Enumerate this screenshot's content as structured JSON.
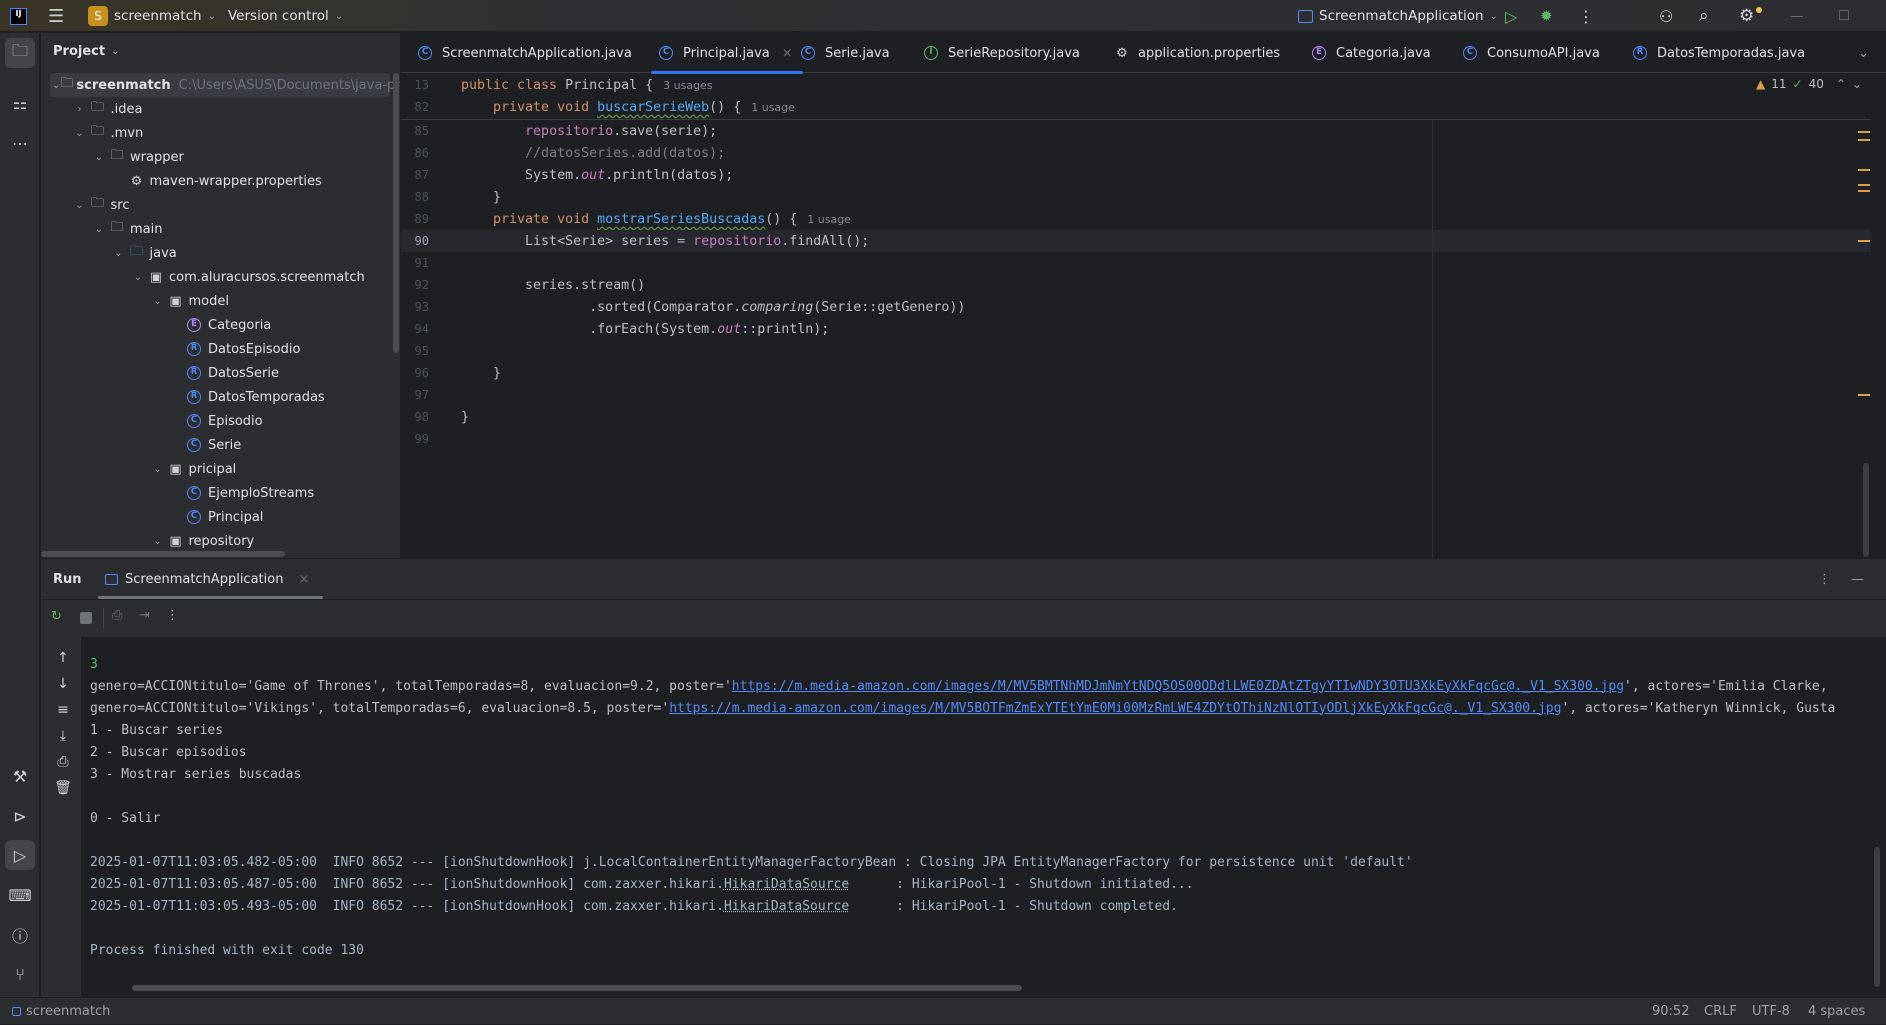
{
  "titlebar": {
    "project_initial": "S",
    "project_name": "screenmatch",
    "vcs": "Version control",
    "run_config": "ScreenmatchApplication"
  },
  "colors": {
    "accent": "#3574f0",
    "run_green": "#5fb865",
    "project_badge": "#c7911b",
    "warning": "#d9a343"
  },
  "project_panel": {
    "title": "Project",
    "items": [
      {
        "label": "screenmatch",
        "path": "C:\\Users\\ASUS\\Documents\\java-pr",
        "depth": 0,
        "arrow": "down",
        "icon": "module-folder"
      },
      {
        "label": ".idea",
        "depth": 1,
        "arrow": "right",
        "icon": "folder"
      },
      {
        "label": ".mvn",
        "depth": 1,
        "arrow": "down",
        "icon": "folder"
      },
      {
        "label": "wrapper",
        "depth": 2,
        "arrow": "down",
        "icon": "folder"
      },
      {
        "label": "maven-wrapper.properties",
        "depth": 3,
        "arrow": "",
        "icon": "gear"
      },
      {
        "label": "src",
        "depth": 1,
        "arrow": "down",
        "icon": "folder"
      },
      {
        "label": "main",
        "depth": 2,
        "arrow": "down",
        "icon": "folder"
      },
      {
        "label": "java",
        "depth": 3,
        "arrow": "down",
        "icon": "source-folder"
      },
      {
        "label": "com.aluracursos.screenmatch",
        "depth": 4,
        "arrow": "down",
        "icon": "package"
      },
      {
        "label": "model",
        "depth": 5,
        "arrow": "down",
        "icon": "package"
      },
      {
        "label": "Categoria",
        "depth": 6,
        "arrow": "",
        "icon": "enum"
      },
      {
        "label": "DatosEpisodio",
        "depth": 6,
        "arrow": "",
        "icon": "record"
      },
      {
        "label": "DatosSerie",
        "depth": 6,
        "arrow": "",
        "icon": "record"
      },
      {
        "label": "DatosTemporadas",
        "depth": 6,
        "arrow": "",
        "icon": "record"
      },
      {
        "label": "Episodio",
        "depth": 6,
        "arrow": "",
        "icon": "class"
      },
      {
        "label": "Serie",
        "depth": 6,
        "arrow": "",
        "icon": "class"
      },
      {
        "label": "pricipal",
        "depth": 5,
        "arrow": "down",
        "icon": "package"
      },
      {
        "label": "EjemploStreams",
        "depth": 6,
        "arrow": "",
        "icon": "class"
      },
      {
        "label": "Principal",
        "depth": 6,
        "arrow": "",
        "icon": "class"
      },
      {
        "label": "repository",
        "depth": 5,
        "arrow": "down",
        "icon": "package"
      }
    ]
  },
  "editor": {
    "tabs": [
      {
        "label": "ScreenmatchApplication.java",
        "icon": "class",
        "active": false
      },
      {
        "label": "Principal.java",
        "icon": "class",
        "active": true
      },
      {
        "label": "Serie.java",
        "icon": "class",
        "active": false
      },
      {
        "label": "SerieRepository.java",
        "icon": "interface",
        "active": false
      },
      {
        "label": "application.properties",
        "icon": "gear",
        "active": false
      },
      {
        "label": "Categoria.java",
        "icon": "enum",
        "active": false
      },
      {
        "label": "ConsumoAPI.java",
        "icon": "class",
        "active": false
      },
      {
        "label": "DatosTemporadas.java",
        "icon": "record",
        "active": false
      }
    ],
    "warnings": "11",
    "ok_count": "40",
    "sticky_lines": [
      {
        "n": "13",
        "tokens": [
          [
            "public class ",
            "k"
          ],
          [
            "Principal {",
            "t"
          ]
        ],
        "hint": "3 usages"
      },
      {
        "n": "82",
        "tokens": [
          [
            "    private void ",
            "k"
          ],
          [
            "buscarSerieWeb",
            "f"
          ],
          [
            "() {",
            "t"
          ]
        ],
        "hint": "1 usage"
      }
    ],
    "lines": [
      {
        "n": "85",
        "tokens": [
          [
            "        ",
            "t"
          ],
          [
            "repositorio",
            "fld"
          ],
          [
            ".save(serie);",
            "t"
          ]
        ]
      },
      {
        "n": "86",
        "tokens": [
          [
            "        //datosSeries.add(datos);",
            "cm"
          ]
        ]
      },
      {
        "n": "87",
        "tokens": [
          [
            "        System.",
            "t"
          ],
          [
            "out",
            "it"
          ],
          [
            ".println(datos);",
            "t"
          ]
        ]
      },
      {
        "n": "88",
        "tokens": [
          [
            "    }",
            "t"
          ]
        ]
      },
      {
        "n": "89",
        "tokens": [
          [
            "    private void ",
            "k"
          ],
          [
            "mostrarSeriesBuscadas",
            "f"
          ],
          [
            "() {",
            "t"
          ]
        ],
        "hint": "1 usage"
      },
      {
        "n": "90",
        "tokens": [
          [
            "        List<Serie> series = ",
            "t"
          ],
          [
            "repositorio",
            "fld"
          ],
          [
            ".findAll();",
            "t"
          ]
        ],
        "current": true
      },
      {
        "n": "91",
        "tokens": []
      },
      {
        "n": "92",
        "tokens": [
          [
            "        series.stream()",
            "t"
          ]
        ]
      },
      {
        "n": "93",
        "tokens": [
          [
            "                .sorted(Comparator.",
            "t"
          ],
          [
            "comparing",
            "itm"
          ],
          [
            "(Serie::getGenero))",
            "t"
          ]
        ]
      },
      {
        "n": "94",
        "tokens": [
          [
            "                .forEach(System.",
            "t"
          ],
          [
            "out",
            "it"
          ],
          [
            "::println);",
            "t"
          ]
        ]
      },
      {
        "n": "95",
        "tokens": []
      },
      {
        "n": "96",
        "tokens": [
          [
            "    }",
            "t"
          ]
        ]
      },
      {
        "n": "97",
        "tokens": []
      },
      {
        "n": "98",
        "tokens": [
          [
            "}",
            "t"
          ]
        ]
      },
      {
        "n": "99",
        "tokens": []
      }
    ]
  },
  "run_panel": {
    "title": "Run",
    "tab": "ScreenmatchApplication",
    "console": [
      {
        "slot": 0,
        "tokens": [
          [
            "3",
            "input"
          ]
        ]
      },
      {
        "slot": 1,
        "tokens": [
          [
            "genero=ACCIONtitulo='Game of Thrones', totalTemporadas=8, evaluacion=9.2, poster='",
            ""
          ],
          [
            "https://m.media-amazon.com/images/M/MV5BMTNhMDJmNmYtNDQ5OS00ODdlLWE0ZDAtZTgyYTIwNDY3OTU3XkEyXkFqcGc@._V1_SX300.jpg",
            "link"
          ],
          [
            "', actores='Emilia Clarke, ",
            ""
          ]
        ]
      },
      {
        "slot": 2,
        "tokens": [
          [
            "genero=ACCIONtitulo='Vikings', totalTemporadas=6, evaluacion=8.5, poster='",
            ""
          ],
          [
            "https://m.media-amazon.com/images/M/MV5BOTFmZmExYTEtYmE0Mi00MzRmLWE4ZDYtOThiNzNlOTIyODljXkEyXkFqcGc@._V1_SX300.jpg",
            "link"
          ],
          [
            "', actores='Katheryn Winnick, Gusta",
            ""
          ]
        ]
      },
      {
        "slot": 3,
        "tokens": [
          [
            "1 - Buscar series",
            ""
          ]
        ]
      },
      {
        "slot": 4,
        "tokens": [
          [
            "2 - Buscar episodios",
            ""
          ]
        ]
      },
      {
        "slot": 5,
        "tokens": [
          [
            "3 - Mostrar series buscadas",
            ""
          ]
        ]
      },
      {
        "slot": 7,
        "tokens": [
          [
            "0 - Salir",
            ""
          ]
        ]
      },
      {
        "slot": 9,
        "tokens": [
          [
            "2025-01-07T11:03:05.482-05:00  INFO 8652 --- [ionShutdownHook] j.LocalContainerEntityManagerFactoryBean : Closing JPA EntityManagerFactory for persistence unit 'default'",
            "log"
          ]
        ]
      },
      {
        "slot": 10,
        "tokens": [
          [
            "2025-01-07T11:03:05.487-05:00  INFO 8652 --- [ionShutdownHook] com.zaxxer.hikari.",
            "log"
          ],
          [
            "HikariDataSource",
            "log dotted"
          ],
          [
            "      : HikariPool-1 - Shutdown initiated...",
            "log"
          ]
        ]
      },
      {
        "slot": 11,
        "tokens": [
          [
            "2025-01-07T11:03:05.493-05:00  INFO 8652 --- [ionShutdownHook] com.zaxxer.hikari.",
            "log"
          ],
          [
            "HikariDataSource",
            "log dotted"
          ],
          [
            "      : HikariPool-1 - Shutdown completed.",
            "log"
          ]
        ]
      },
      {
        "slot": 13,
        "tokens": [
          [
            "Process finished with exit code 130",
            "log"
          ]
        ]
      }
    ]
  },
  "statusbar": {
    "project": "screenmatch",
    "position": "90:52",
    "line_separator": "CRLF",
    "encoding": "UTF-8",
    "indent": "4 spaces"
  }
}
